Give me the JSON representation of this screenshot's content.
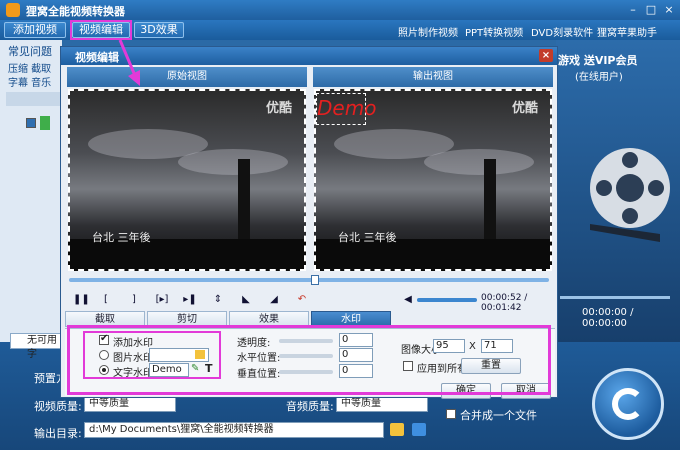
{
  "app": {
    "title": "狸窝全能视频转换器",
    "toolbar": {
      "add_video": "添加视频",
      "video_edit": "视频编辑",
      "effect_3d": "3D效果",
      "links": [
        "照片制作视频",
        "PPT转换视频",
        "DVD刻录软件",
        "狸窝苹果助手"
      ]
    },
    "left_panel": {
      "faq": "常见问题",
      "row1": "压缩 截取",
      "row2": "字幕 音乐"
    },
    "right_panel": {
      "promo": "游戏 送VIP会员",
      "online_user": "(在线用户)",
      "time": "00:00:00 / 00:00:00"
    },
    "bottom": {
      "no_subtitle": "无可用字",
      "preset_label": "预置方",
      "video_quality_label": "视频质量:",
      "video_quality": "中等质量",
      "audio_quality_label": "音频质量:",
      "audio_quality": "中等质量",
      "merge_label": "合并成一个文件",
      "output_label": "输出目录:",
      "output_path": "d:\\My Documents\\狸窝\\全能视频转换器"
    }
  },
  "dialog": {
    "title": "视频编辑",
    "original_view": "原始视图",
    "output_view": "输出视图",
    "video_logo": "优酷",
    "video_caption": "台北 三年後",
    "demo_text": "Demo",
    "time": "00:00:52 / 00:01:42",
    "tabs": [
      "截取",
      "剪切",
      "效果",
      "水印"
    ],
    "active_tab": "水印",
    "watermark": {
      "add_label": "添加水印",
      "image_label": "图片水印:",
      "text_label": "文字水印:",
      "text_value": "Demo",
      "transparency_label": "透明度:",
      "h_pos_label": "水平位置:",
      "v_pos_label": "垂直位置:",
      "transparency": "0",
      "h_pos": "0",
      "v_pos": "0",
      "image_size_label": "图像大小",
      "width": "95",
      "times": "X",
      "height": "71",
      "apply_all": "应用到所有",
      "reset": "重置"
    },
    "ok": "确定",
    "cancel": "取消"
  },
  "colors": {
    "highlight": "#e23ad8",
    "title_blue": "#1d5ea0",
    "active_tab": "#2a6bab"
  }
}
